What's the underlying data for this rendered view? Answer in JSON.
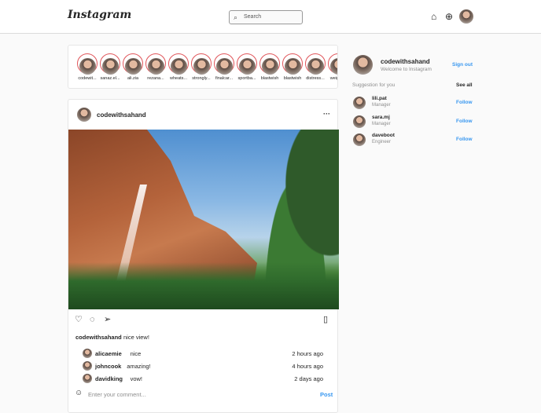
{
  "header": {
    "logo": "Instagram",
    "search_placeholder": "Search"
  },
  "stories": [
    "codewit...",
    "sanaz.el...",
    "ali.zia",
    "rezana...",
    "wheats...",
    "strongly...",
    "finalcar...",
    "sportba...",
    "blastwish",
    "blastwish",
    "distress...",
    "weight..."
  ],
  "post": {
    "username": "codewithsahand",
    "more": "···",
    "caption_user": "codewithsahand",
    "caption": "nice view!",
    "comments": [
      {
        "user": "alicaemie",
        "text": "nice",
        "time": "2 hours ago"
      },
      {
        "user": "johncook",
        "text": "amazing!",
        "time": "4 hours ago"
      },
      {
        "user": "davidking",
        "text": "vow!",
        "time": "2 days ago"
      }
    ],
    "comment_placeholder": "Enter your comment...",
    "post_label": "Post"
  },
  "sidebar": {
    "username": "codewithsahand",
    "subtitle": "Welcome to Instagram",
    "signout": "Sign out",
    "suggestion_title": "Suggestion for you",
    "see_all": "See all",
    "suggestions": [
      {
        "name": "lili.pat",
        "role": "Manager",
        "action": "Follow"
      },
      {
        "name": "sara.mj",
        "role": "Manager",
        "action": "Follow"
      },
      {
        "name": "daveboot",
        "role": "Engineer",
        "action": "Follow"
      }
    ]
  }
}
